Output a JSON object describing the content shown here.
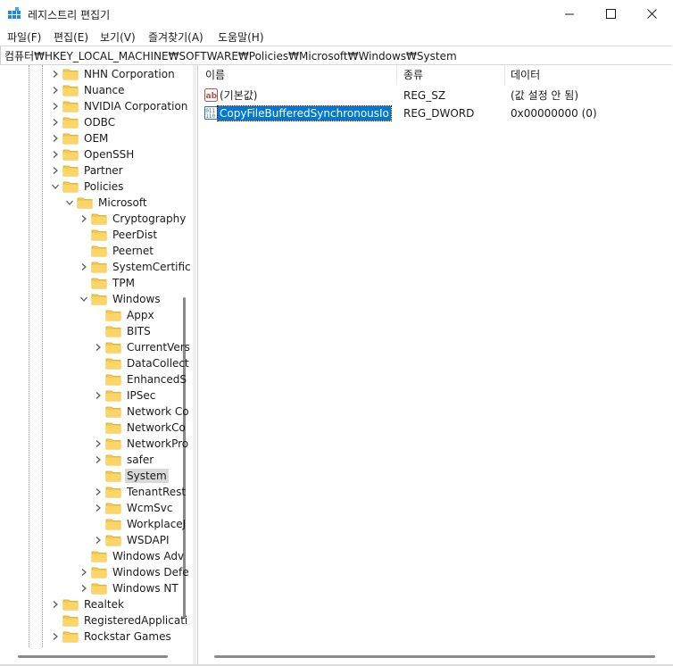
{
  "window": {
    "title": "레지스트리 편집기",
    "controls": [
      "minimize-icon",
      "maximize-icon",
      "close-icon"
    ]
  },
  "menu": [
    {
      "label": "파일(F)"
    },
    {
      "label": "편집(E)"
    },
    {
      "label": "보기(V)"
    },
    {
      "label": "즐겨찾기(A)"
    },
    {
      "label": "도움말(H)"
    }
  ],
  "address": "컴퓨터₩HKEY_LOCAL_MACHINE₩SOFTWARE₩Policies₩Microsoft₩Windows₩System",
  "tree": [
    {
      "label": "NHN Corporation",
      "level": 0,
      "expander": "collapsed"
    },
    {
      "label": "Nuance",
      "level": 0,
      "expander": "collapsed"
    },
    {
      "label": "NVIDIA Corporation",
      "level": 0,
      "expander": "collapsed"
    },
    {
      "label": "ODBC",
      "level": 0,
      "expander": "collapsed"
    },
    {
      "label": "OEM",
      "level": 0,
      "expander": "collapsed"
    },
    {
      "label": "OpenSSH",
      "level": 0,
      "expander": "collapsed"
    },
    {
      "label": "Partner",
      "level": 0,
      "expander": "collapsed"
    },
    {
      "label": "Policies",
      "level": 0,
      "expander": "expanded"
    },
    {
      "label": "Microsoft",
      "level": 1,
      "expander": "expanded"
    },
    {
      "label": "Cryptography",
      "level": 2,
      "expander": "collapsed"
    },
    {
      "label": "PeerDist",
      "level": 2,
      "expander": "none"
    },
    {
      "label": "Peernet",
      "level": 2,
      "expander": "none"
    },
    {
      "label": "SystemCertific",
      "level": 2,
      "expander": "collapsed"
    },
    {
      "label": "TPM",
      "level": 2,
      "expander": "none"
    },
    {
      "label": "Windows",
      "level": 2,
      "expander": "expanded"
    },
    {
      "label": "Appx",
      "level": 3,
      "expander": "none"
    },
    {
      "label": "BITS",
      "level": 3,
      "expander": "none"
    },
    {
      "label": "CurrentVers",
      "level": 3,
      "expander": "collapsed"
    },
    {
      "label": "DataCollect",
      "level": 3,
      "expander": "none"
    },
    {
      "label": "EnhancedS",
      "level": 3,
      "expander": "none"
    },
    {
      "label": "IPSec",
      "level": 3,
      "expander": "collapsed"
    },
    {
      "label": "Network Co",
      "level": 3,
      "expander": "none"
    },
    {
      "label": "NetworkCo",
      "level": 3,
      "expander": "none"
    },
    {
      "label": "NetworkPro",
      "level": 3,
      "expander": "collapsed"
    },
    {
      "label": "safer",
      "level": 3,
      "expander": "collapsed"
    },
    {
      "label": "System",
      "level": 3,
      "expander": "none",
      "selected": true
    },
    {
      "label": "TenantRest",
      "level": 3,
      "expander": "collapsed"
    },
    {
      "label": "WcmSvc",
      "level": 3,
      "expander": "collapsed"
    },
    {
      "label": "WorkplaceJ",
      "level": 3,
      "expander": "none"
    },
    {
      "label": "WSDAPI",
      "level": 3,
      "expander": "collapsed"
    },
    {
      "label": "Windows Adv",
      "level": 2,
      "expander": "none"
    },
    {
      "label": "Windows Defe",
      "level": 2,
      "expander": "collapsed"
    },
    {
      "label": "Windows NT",
      "level": 2,
      "expander": "collapsed"
    },
    {
      "label": "Realtek",
      "level": 0,
      "expander": "collapsed"
    },
    {
      "label": "RegisteredApplicati",
      "level": 0,
      "expander": "none"
    },
    {
      "label": "Rockstar Games",
      "level": 0,
      "expander": "collapsed"
    }
  ],
  "columns": {
    "name": "이름",
    "type": "종류",
    "data": "데이터"
  },
  "values": [
    {
      "icon": "string-value-icon",
      "name": "(기본값)",
      "type": "REG_SZ",
      "data": "(값 설정 안 됨)",
      "selected": false
    },
    {
      "icon": "dword-value-icon",
      "name": "CopyFileBufferedSynchronousIo",
      "type": "REG_DWORD",
      "data": "0x00000000 (0)",
      "selected": true
    }
  ],
  "colors": {
    "folder": "#f8c94a",
    "selection": "#0078d7",
    "tree_selection": "#d9d9d9"
  }
}
